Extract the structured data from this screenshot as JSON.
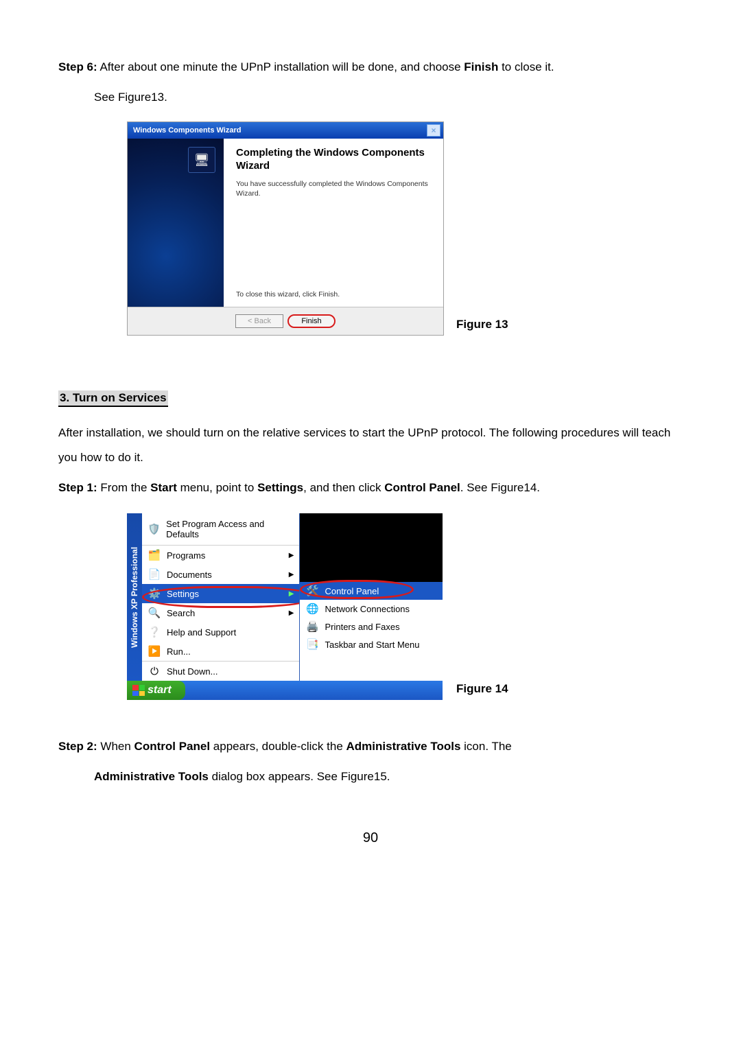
{
  "step6": {
    "label": "Step 6:",
    "text": " After about one minute the UPnP installation will be done, and choose ",
    "bold": "Finish",
    "text2": " to close it.",
    "see": "See Figure13."
  },
  "wizard": {
    "title": "Windows Components Wizard",
    "heading": "Completing the Windows Components Wizard",
    "sub": "You have successfully completed the Windows Components Wizard.",
    "closeHint": "To close this wizard, click Finish.",
    "back": "< Back",
    "finish": "Finish"
  },
  "fig13": "Figure 13",
  "section3": "3. Turn on Services",
  "afterInstall": "After installation, we should turn on the relative services to start the UPnP protocol. The following procedures will teach you how to do it.",
  "step1": {
    "label": "Step 1:",
    "t1": " From the ",
    "b1": "Start",
    "t2": " menu, point to ",
    "b2": "Settings",
    "t3": ", and then click ",
    "b3": "Control Panel",
    "t4": ". See Figure14."
  },
  "startmenu": {
    "stripe": "Windows XP Professional",
    "items": [
      {
        "label": "Set Program Access and Defaults",
        "icon": "🛡️",
        "big": true
      },
      {
        "label": "Programs",
        "icon": "🗂️",
        "arrow": true,
        "sep": true
      },
      {
        "label": "Documents",
        "icon": "📄",
        "arrow": true
      },
      {
        "label": "Settings",
        "icon": "⚙️",
        "arrow": true,
        "hover": true
      },
      {
        "label": "Search",
        "icon": "🔍",
        "arrow": true
      },
      {
        "label": "Help and Support",
        "icon": "❔"
      },
      {
        "label": "Run...",
        "icon": "▶️"
      },
      {
        "label": "Shut Down...",
        "icon": "⏻",
        "sep": true
      }
    ],
    "sub": [
      {
        "label": "Control Panel",
        "icon": "🛠️",
        "hover": true
      },
      {
        "label": "Network Connections",
        "icon": "🌐"
      },
      {
        "label": "Printers and Faxes",
        "icon": "🖨️"
      },
      {
        "label": "Taskbar and Start Menu",
        "icon": "📑"
      }
    ],
    "startLabel": "start"
  },
  "fig14": "Figure 14",
  "step2": {
    "label": "Step 2:",
    "t1": " When ",
    "b1": "Control Panel",
    "t2": " appears, double-click the ",
    "b2": "Administrative Tools",
    "t3": " icon. The",
    "line2a": "Administrative Tools",
    "line2b": " dialog box appears. See Figure15."
  },
  "pageNum": "90"
}
